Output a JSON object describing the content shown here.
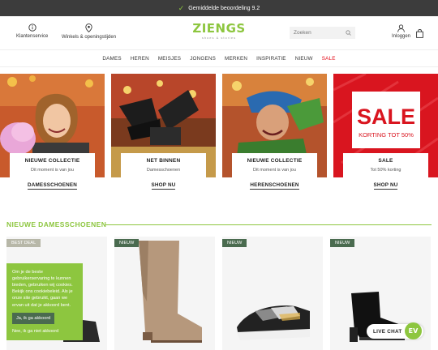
{
  "topbar": {
    "text": "Gemiddelde beoordeling 9.2"
  },
  "header": {
    "customer_service": "Klantenservice",
    "stores": "Winkels & openingstijden",
    "logo": "ZIENGS",
    "logo_sub": "shoes & stories",
    "search_placeholder": "Zoeken",
    "login": "Inloggen"
  },
  "nav": {
    "items": [
      "DAMES",
      "HEREN",
      "MEISJES",
      "JONGENS",
      "MERKEN",
      "INSPIRATIE",
      "NIEUW",
      "SALE"
    ]
  },
  "promos": [
    {
      "title": "NIEUWE COLLECTIE",
      "subtitle": "Dit moment is van jou",
      "cta": "DAMESSCHOENEN"
    },
    {
      "title": "NET BINNEN",
      "subtitle": "Damesschoenen",
      "cta": "SHOP NU"
    },
    {
      "title": "NIEUWE COLLECTIE",
      "subtitle": "Dit moment is van jou",
      "cta": "HERENSCHOENEN"
    },
    {
      "title": "SALE",
      "subtitle": "Tot 50% korting",
      "cta": "SHOP NU",
      "image_text": "SALE",
      "image_subtext": "KORTING TOT 50%"
    }
  ],
  "section": {
    "title": "NIEUWE DAMESSCHOENEN"
  },
  "products": [
    {
      "badge": "BEST DEAL"
    },
    {
      "badge": "NIEUW"
    },
    {
      "badge": "NIEUW"
    },
    {
      "badge": "NIEUW"
    }
  ],
  "cookie": {
    "text": "Om je de beste gebruikerservaring te kunnen bieden, gebruiken wij cookies. Bekijk ons cookiebeleid. Als je onze site gebruikt, gaan we ervan uit dat je akkoord bent.",
    "accept": "Ja, ik ga akkoord",
    "decline": "Nee, ik ga niet akkoord"
  },
  "chat": {
    "label": "LIVE CHAT",
    "badge": "EV"
  },
  "colors": {
    "brand_green": "#8dc63f",
    "dark_green": "#4a6b4f",
    "sale_red": "#e30613",
    "topbar": "#3c3c3c"
  }
}
